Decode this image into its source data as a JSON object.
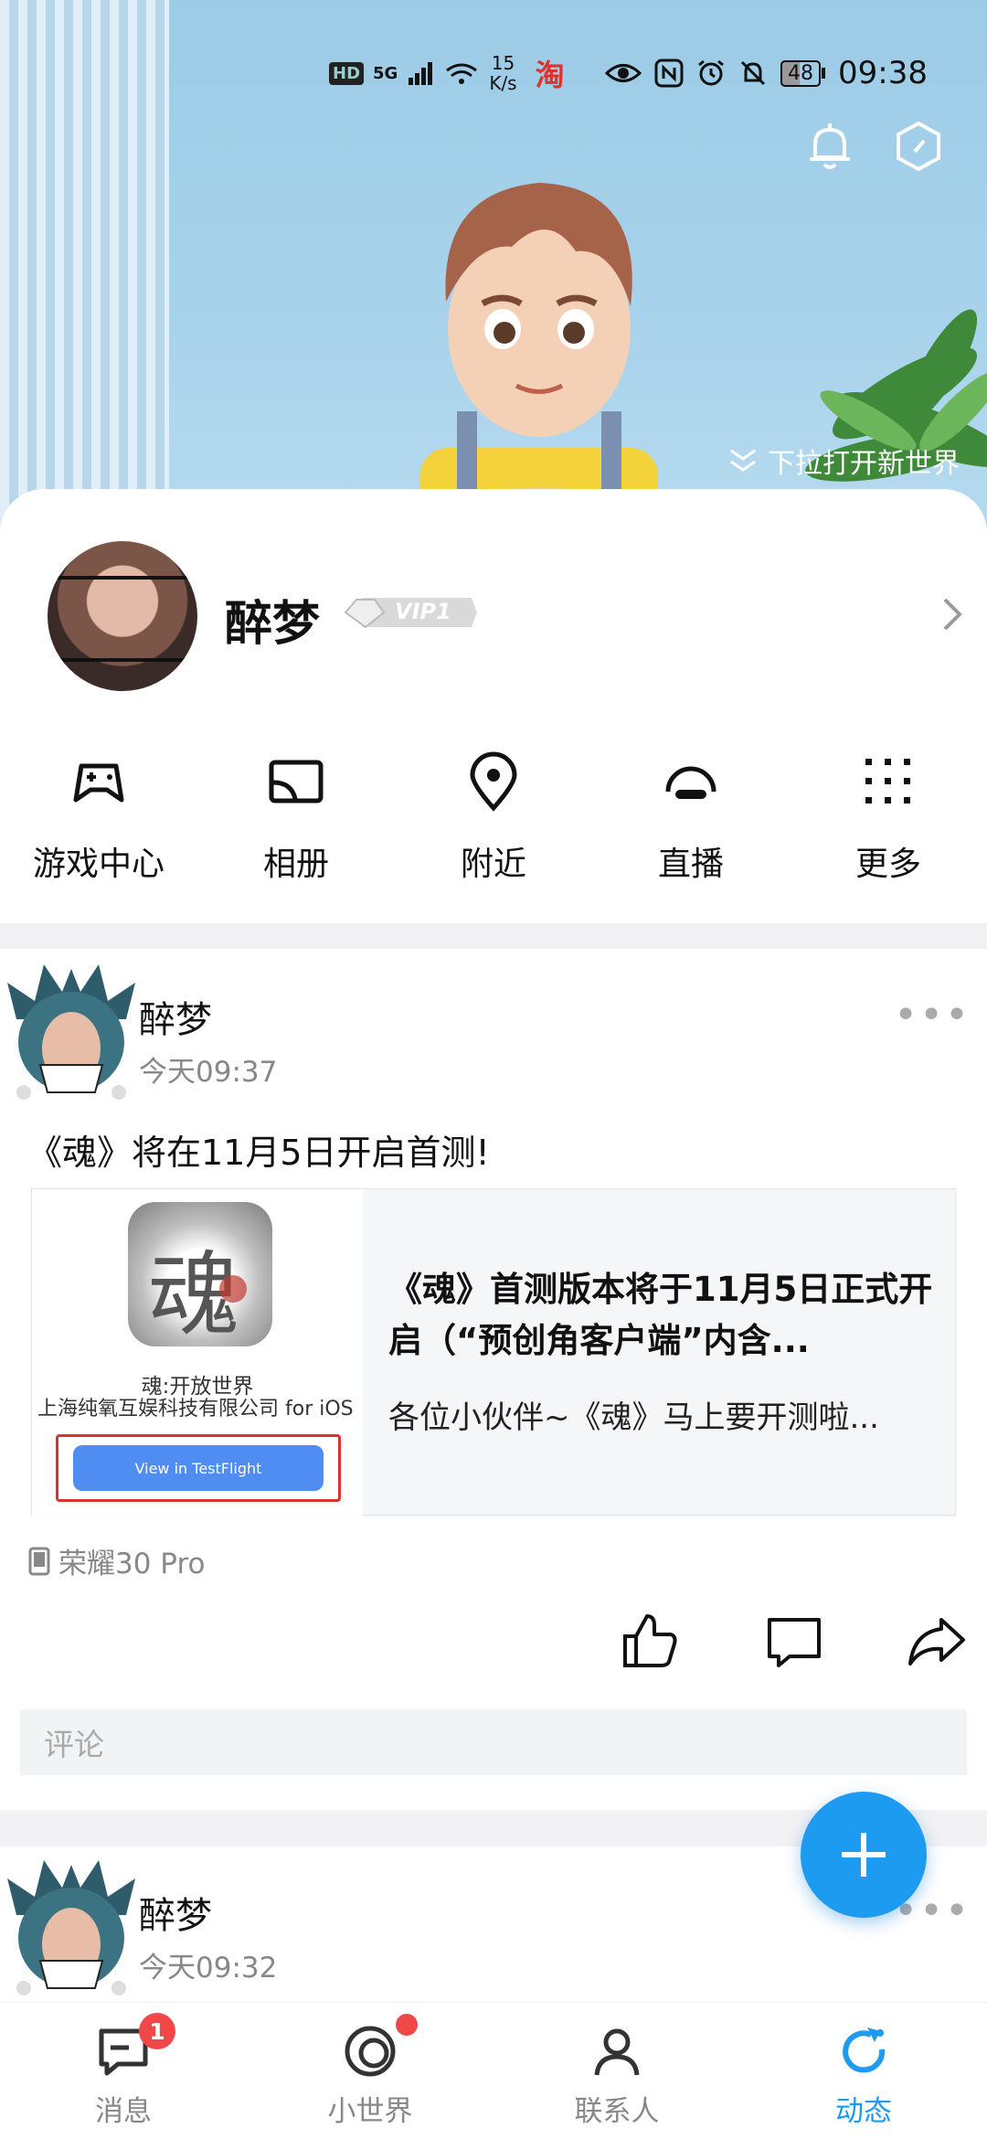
{
  "status_bar": {
    "hd": "HD",
    "net": "5G",
    "speed_value": "15",
    "speed_unit": "K/s",
    "taobao": "淘",
    "battery": "48",
    "time": "09:38"
  },
  "hero": {
    "hint": "下拉打开新世界"
  },
  "profile": {
    "name": "醉梦",
    "vip": "VIP1"
  },
  "quick_actions": [
    {
      "label": "游戏中心",
      "icon": "gamepad-icon"
    },
    {
      "label": "相册",
      "icon": "album-icon"
    },
    {
      "label": "附近",
      "icon": "location-pin-icon"
    },
    {
      "label": "直播",
      "icon": "live-icon"
    },
    {
      "label": "更多",
      "icon": "grid-dots-icon"
    }
  ],
  "posts": [
    {
      "author": "醉梦",
      "time": "今天09:37",
      "text": "《魂》将在11月5日开启首测!",
      "link": {
        "app_name": "魂:开放世界",
        "company": "上海纯氧互娱科技有限公司 for iOS",
        "testflight_button": "View in TestFlight",
        "title": "《魂》首测版本将于11月5日正式开启（“预创角客户端”内含...",
        "description": "各位小伙伴~《魂》马上要开测啦..."
      },
      "device": "荣耀30 Pro",
      "comment_placeholder": "评论"
    },
    {
      "author": "醉梦",
      "time": "今天09:32"
    }
  ],
  "bottom_nav": [
    {
      "label": "消息",
      "icon": "message-icon",
      "badge": "1"
    },
    {
      "label": "小世界",
      "icon": "world-icon"
    },
    {
      "label": "联系人",
      "icon": "contacts-icon"
    },
    {
      "label": "动态",
      "icon": "refresh-feed-icon",
      "active": true
    }
  ],
  "colors": {
    "accent": "#1d9bf0",
    "badge": "#f04848",
    "testflight": "#4f8df2"
  }
}
